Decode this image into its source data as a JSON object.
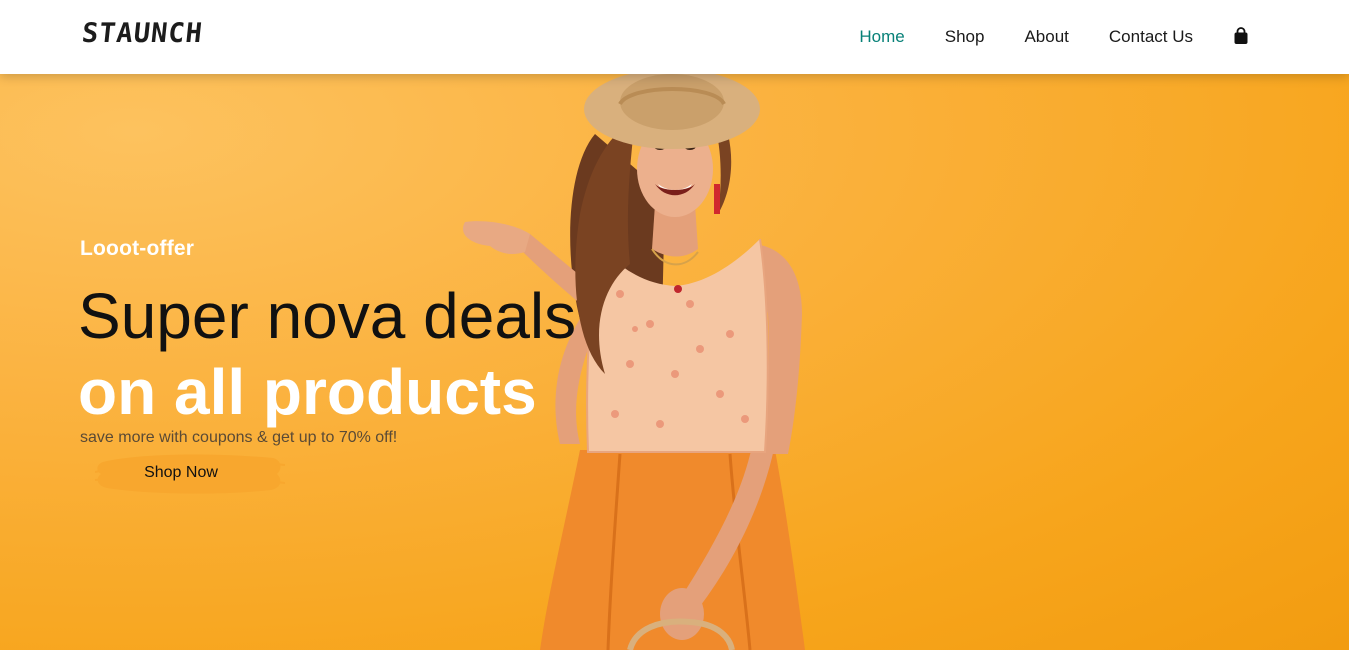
{
  "header": {
    "logo": "STAUNCH",
    "nav": {
      "home": "Home",
      "shop": "Shop",
      "about": "About",
      "contact": "Contact Us"
    },
    "cart_icon": "shopping-bag-icon",
    "active_color": "#088178"
  },
  "hero": {
    "subtitle": "Looot-offer",
    "headline_line1": "Super nova deals",
    "headline_line2": "on all products",
    "tagline": "save more with coupons & get up to 70% off!",
    "button_label": "Shop Now",
    "background_color": "#f7a51c"
  }
}
